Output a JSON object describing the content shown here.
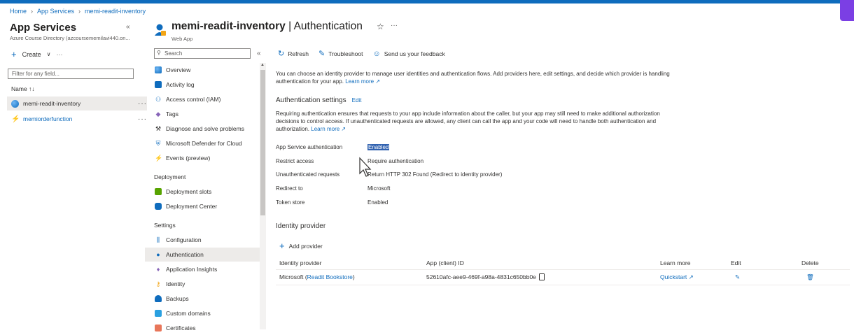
{
  "breadcrumb": [
    "Home",
    "App Services",
    "memi-readit-inventory"
  ],
  "left_pane": {
    "title": "App Services",
    "subtitle": "Azure Course Directory (azcoursememilavi440.on...",
    "create_label": "Create",
    "filter_placeholder": "Filter for any field...",
    "name_header": "Name ↑↓",
    "items": [
      {
        "label": "memi-readit-inventory",
        "selected": true
      },
      {
        "label": "memiorderfunction",
        "selected": false
      }
    ]
  },
  "header": {
    "resource_name": "memi-readit-inventory",
    "page_name": "| Authentication",
    "subtitle": "Web App"
  },
  "menu": {
    "search_placeholder": "Search",
    "items_top": [
      "Overview",
      "Activity log",
      "Access control (IAM)",
      "Tags",
      "Diagnose and solve problems",
      "Microsoft Defender for Cloud",
      "Events (preview)"
    ],
    "deployment_label": "Deployment",
    "deployment_items": [
      "Deployment slots",
      "Deployment Center"
    ],
    "settings_label": "Settings",
    "settings_items": [
      "Configuration",
      "Authentication",
      "Application Insights",
      "Identity",
      "Backups",
      "Custom domains",
      "Certificates"
    ]
  },
  "toolbar": {
    "refresh": "Refresh",
    "troubleshoot": "Troubleshoot",
    "feedback": "Send us your feedback"
  },
  "content": {
    "intro": "You can choose an identity provider to manage user identities and authentication flows. Add providers here, edit settings, and decide which provider is handling authentication for your app.",
    "learn_more": "Learn more",
    "auth_settings_title": "Authentication settings",
    "edit_label": "Edit",
    "auth_desc": "Requiring authentication ensures that requests to your app include information about the caller, but your app may still need to make additional authorization decisions to control access. If unauthenticated requests are allowed, any client can call the app and your code will need to handle both authentication and authorization.",
    "settings": [
      {
        "key": "App Service authentication",
        "value": "Enabled"
      },
      {
        "key": "Restrict access",
        "value": "Require authentication"
      },
      {
        "key": "Unauthenticated requests",
        "value": "Return HTTP 302 Found (Redirect to identity provider)"
      },
      {
        "key": "Redirect to",
        "value": "Microsoft"
      },
      {
        "key": "Token store",
        "value": "Enabled"
      }
    ],
    "identity_provider_title": "Identity provider",
    "add_provider": "Add provider",
    "table_headers": [
      "Identity provider",
      "App (client) ID",
      "Learn more",
      "Edit",
      "Delete"
    ],
    "row": {
      "provider": "Microsoft (",
      "provider_link": "Readit Bookstore",
      "provider_close": ")",
      "client_id": "52610afc-aee9-469f-a98a-4831c650bb0e",
      "learn_more": "Quickstart"
    }
  }
}
